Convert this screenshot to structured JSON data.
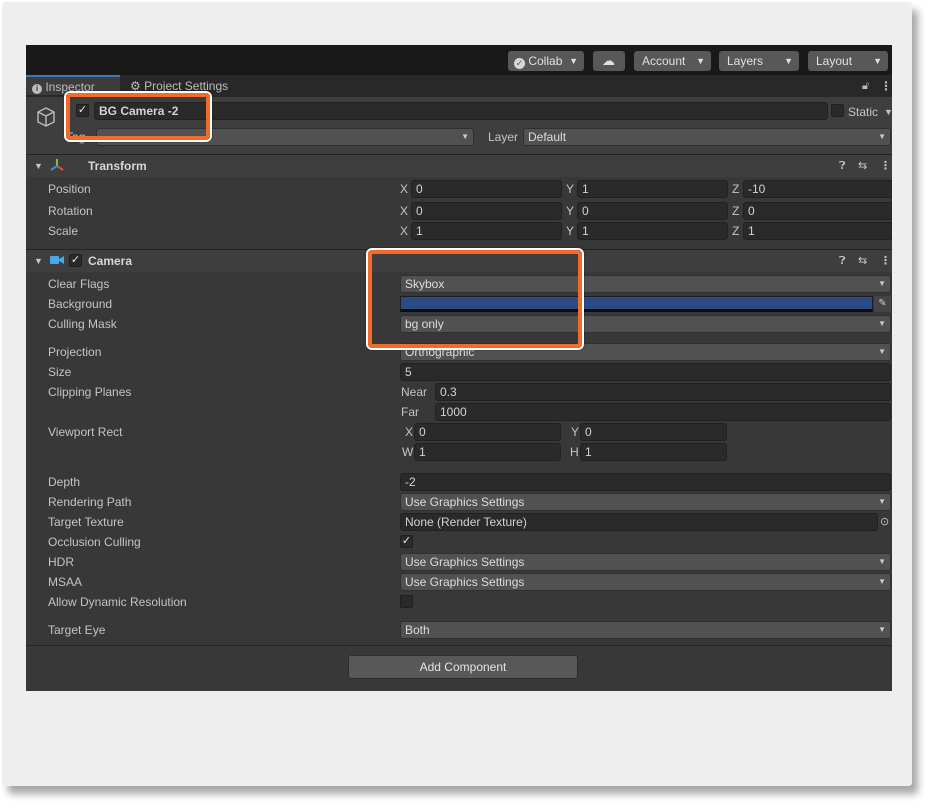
{
  "toolbar": {
    "collab": "Collab",
    "account": "Account",
    "layers": "Layers",
    "layout": "Layout"
  },
  "tabs": {
    "inspector": "Inspector",
    "project_settings": "Project Settings"
  },
  "object": {
    "name": "BG Camera -2",
    "static_label": "Static",
    "layer_label": "Layer",
    "layer_value": "Default"
  },
  "transform": {
    "title": "Transform",
    "rows": [
      {
        "label": "Position",
        "x": "0",
        "y": "1",
        "z": "-10"
      },
      {
        "label": "Rotation",
        "x": "0",
        "y": "0",
        "z": "0"
      },
      {
        "label": "Scale",
        "x": "1",
        "y": "1",
        "z": "1"
      }
    ],
    "axis": {
      "x": "X",
      "y": "Y",
      "z": "Z"
    }
  },
  "camera": {
    "title": "Camera",
    "clear_flags": {
      "label": "Clear Flags",
      "value": "Skybox"
    },
    "background": {
      "label": "Background",
      "color": "#2b4b86"
    },
    "culling_mask": {
      "label": "Culling Mask",
      "value": "bg only"
    },
    "projection": {
      "label": "Projection",
      "value": "Orthographic"
    },
    "size": {
      "label": "Size",
      "value": "5"
    },
    "clipping": {
      "label": "Clipping Planes",
      "near_label": "Near",
      "near": "0.3",
      "far_label": "Far",
      "far": "1000"
    },
    "viewport": {
      "label": "Viewport Rect",
      "x_label": "X",
      "x": "0",
      "y_label": "Y",
      "y": "0",
      "w_label": "W",
      "w": "1",
      "h_label": "H",
      "h": "1"
    },
    "depth": {
      "label": "Depth",
      "value": "-2"
    },
    "rendering_path": {
      "label": "Rendering Path",
      "value": "Use Graphics Settings"
    },
    "target_texture": {
      "label": "Target Texture",
      "value": "None (Render Texture)"
    },
    "occlusion_culling": {
      "label": "Occlusion Culling",
      "checked": true
    },
    "hdr": {
      "label": "HDR",
      "value": "Use Graphics Settings"
    },
    "msaa": {
      "label": "MSAA",
      "value": "Use Graphics Settings"
    },
    "dynamic_resolution": {
      "label": "Allow Dynamic Resolution",
      "checked": false
    },
    "target_eye": {
      "label": "Target Eye",
      "value": "Both"
    }
  },
  "add_component": "Add Component",
  "colors": {
    "highlight": "#f26b2a",
    "accent_tab": "#3a79bb",
    "panel": "#383838"
  }
}
